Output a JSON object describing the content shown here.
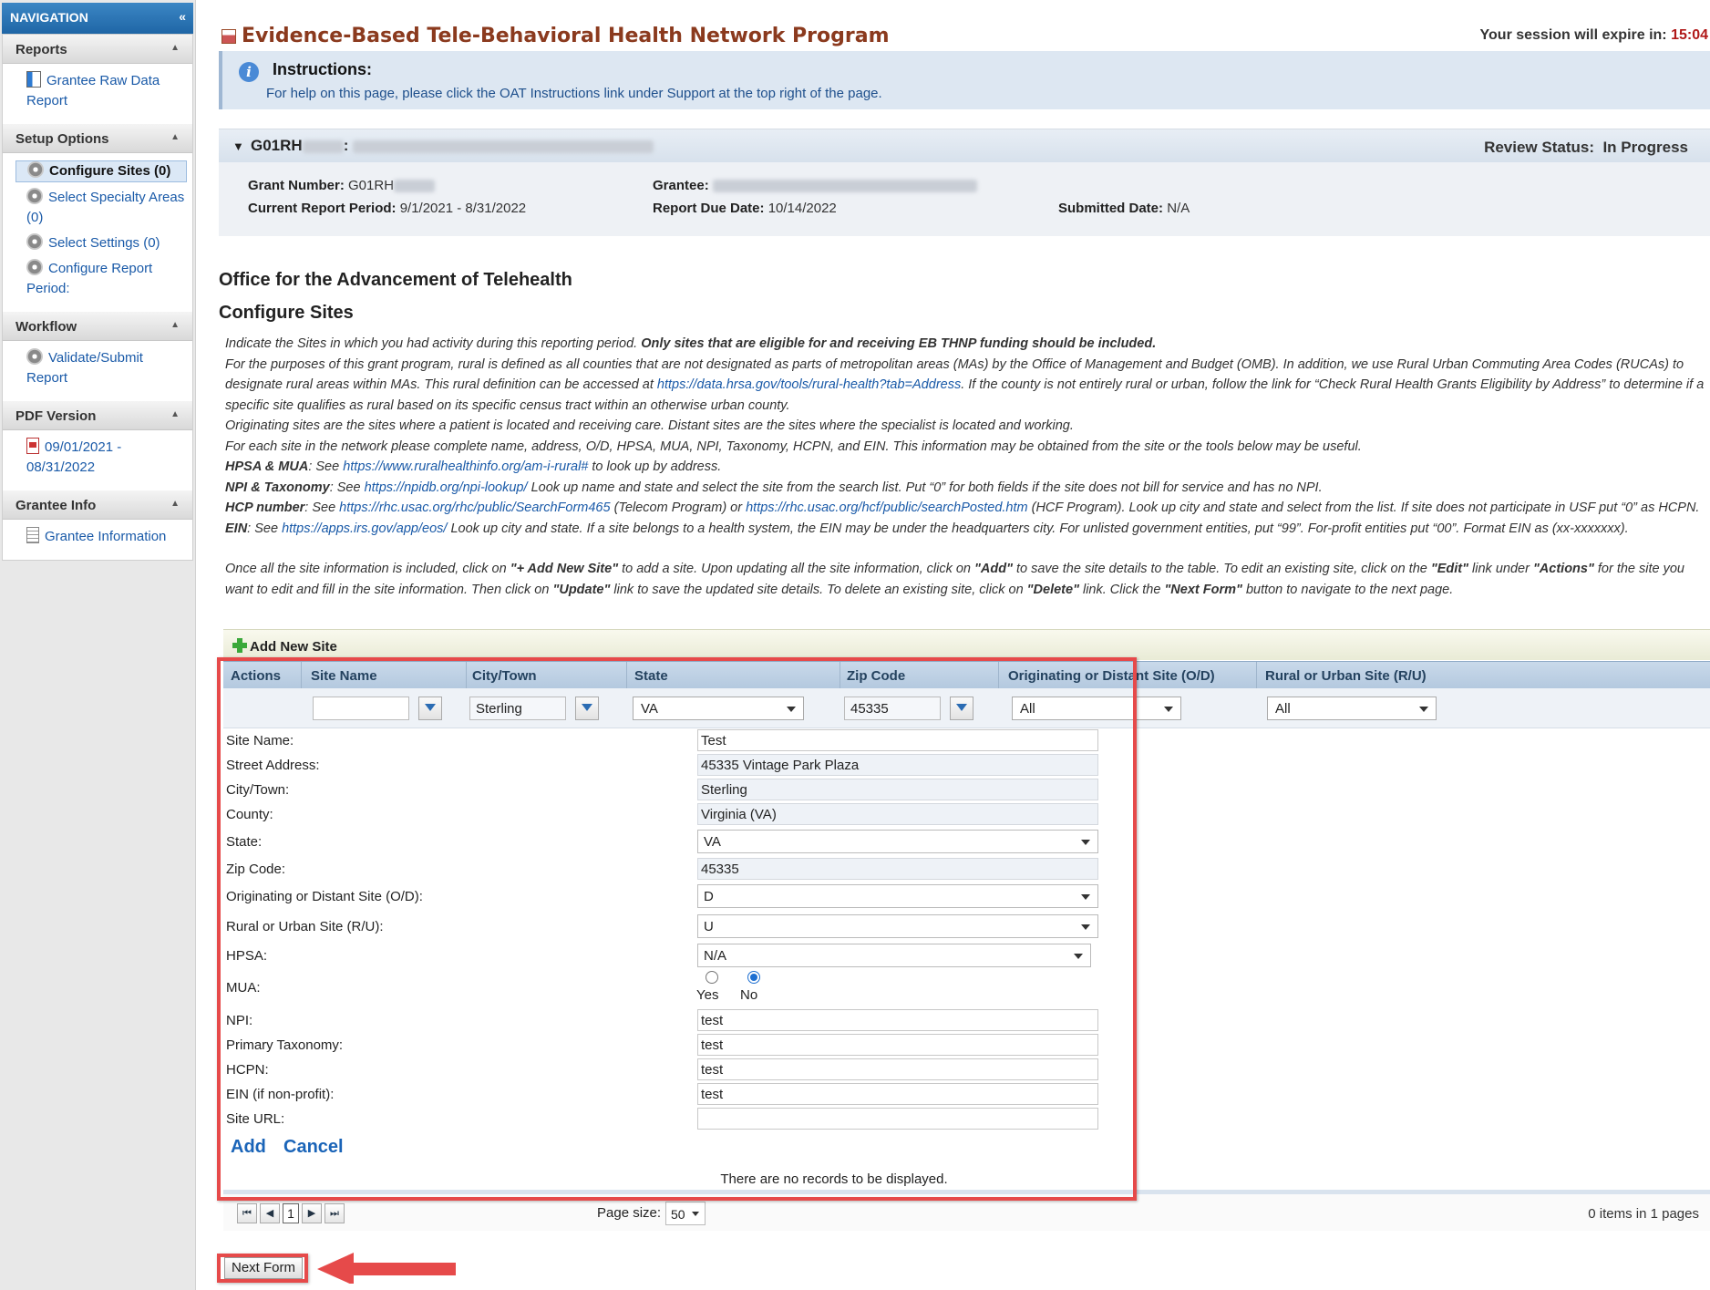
{
  "nav": {
    "title": "NAVIGATION",
    "collapse_icon": "«",
    "sections": [
      {
        "title": "Reports",
        "items": [
          {
            "icon": "report-icon",
            "label": "Grantee Raw Data Report"
          }
        ]
      },
      {
        "title": "Setup Options",
        "items": [
          {
            "icon": "gear-icon",
            "label": "Configure Sites (0)",
            "active": true
          },
          {
            "icon": "gear-icon",
            "label": "Select Specialty Areas (0)"
          },
          {
            "icon": "gear-icon",
            "label": "Select Settings (0)"
          },
          {
            "icon": "gear-icon",
            "label": "Configure Report Period:"
          }
        ]
      },
      {
        "title": "Workflow",
        "items": [
          {
            "icon": "gear-icon",
            "label": "Validate/Submit Report"
          }
        ]
      },
      {
        "title": "PDF Version",
        "items": [
          {
            "icon": "pdf-icon",
            "label": "09/01/2021 - 08/31/2022"
          }
        ]
      },
      {
        "title": "Grantee Info",
        "items": [
          {
            "icon": "document-icon",
            "label": "Grantee Information"
          }
        ]
      }
    ]
  },
  "header": {
    "title": "Evidence-Based Tele-Behavioral Health Network Program",
    "session_label": "Your session will expire in:",
    "session_time": "15:04"
  },
  "instructions": {
    "title": "Instructions:",
    "text": "For help on this page, please click the OAT Instructions link under Support at the top right of the page."
  },
  "grant": {
    "id_prefix": "G01RH",
    "review_status_label": "Review Status:",
    "review_status": "In Progress",
    "grant_number_label": "Grant Number:",
    "grant_number": "G01RH",
    "grantee_label": "Grantee:",
    "period_label": "Current Report Period:",
    "period": "9/1/2021 - 8/31/2022",
    "due_label": "Report Due Date:",
    "due": "10/14/2022",
    "submitted_label": "Submitted Date:",
    "submitted": "N/A"
  },
  "office_title": "Office for the Advancement of Telehealth",
  "page_title": "Configure Sites",
  "description": {
    "p1a": "Indicate the Sites in which you had activity during this reporting period.",
    "p1b": "Only sites that are eligible for and receiving EB THNP funding should be included.",
    "p2a": "For the purposes of this grant program, rural is defined as all counties that are not designated as parts of metropolitan areas (MAs) by the Office of Management and Budget (OMB). In addition, we use Rural Urban Commuting Area Codes (RUCAs) to designate rural areas within MAs. This rural definition can be accessed at",
    "p2link": "https://data.hrsa.gov/tools/rural-health?tab=Address",
    "p2b": ". If the county is not entirely rural or urban, follow the link for “Check Rural Health Grants Eligibility by Address” to determine if a specific site qualifies as rural based on its specific census tract within an otherwise urban county.",
    "p3": "Originating sites are the sites where a patient is located and receiving care. Distant sites are the sites where the specialist is located and working.",
    "p4": "For each site in the network please complete name, address, O/D, HPSA, MUA, NPI, Taxonomy, HCPN, and EIN. This information may be obtained from the site or the tools below may be useful.",
    "hpsa_label": "HPSA & MUA",
    "hpsa_a": ": See",
    "hpsa_link": "https://www.ruralhealthinfo.org/am-i-rural#",
    "hpsa_b": "to look up by address.",
    "npi_label": "NPI & Taxonomy",
    "npi_a": ": See",
    "npi_link": "https://npidb.org/npi-lookup/",
    "npi_b": "Look up name and state and select the site from the search list. Put “0” for both fields if the site does not bill for service and has no NPI.",
    "hcp_label": "HCP number",
    "hcp_a": ": See",
    "hcp_link1": "https://rhc.usac.org/rhc/public/SearchForm465",
    "hcp_b": "(Telecom Program) or",
    "hcp_link2": "https://rhc.usac.org/hcf/public/searchPosted.htm",
    "hcp_c": "(HCF Program). Look up city and state and select from the list. If site does not participate in USF put “0” as HCPN.",
    "ein_label": "EIN",
    "ein_a": ": See",
    "ein_link": "https://apps.irs.gov/app/eos/",
    "ein_b": "Look up city and state. If a site belongs to a health system, the EIN may be under the headquarters city. For unlisted government entities, put “99”. For-profit entities put “00”. Format EIN as (xx-xxxxxxx).",
    "p5_1": "Once all the site information is included, click on",
    "p5_2": "\"+ Add New Site\"",
    "p5_3": "to add a site. Upon updating all the site information, click on",
    "p5_4": "\"Add\"",
    "p5_5": "to save the site details to the table. To edit an existing site, click on the",
    "p5_6": "\"Edit\"",
    "p5_7": "link under",
    "p5_8": "\"Actions\"",
    "p5_9": "for the site you want to edit and fill in the site information. Then click on",
    "p5_10": "\"Update\"",
    "p5_11": "link to save the updated site details. To delete an existing site, click on",
    "p5_12": "\"Delete\"",
    "p5_13": "link. Click the",
    "p5_14": "\"Next Form\"",
    "p5_15": "button to navigate to the next page."
  },
  "grid": {
    "add_label": "Add New Site",
    "columns": [
      "Actions",
      "Site Name",
      "City/Town",
      "State",
      "Zip Code",
      "Originating or Distant Site (O/D)",
      "Rural or Urban Site (R/U)"
    ],
    "filters": {
      "site_name": "",
      "city": "Sterling",
      "state": "VA",
      "zip": "45335",
      "od": "All",
      "ru": "All"
    },
    "no_records": "There are no records to be displayed."
  },
  "form": {
    "site_name_label": "Site Name:",
    "site_name": "Test",
    "street_label": "Street Address:",
    "street": "45335 Vintage Park Plaza",
    "city_label": "City/Town:",
    "city": "Sterling",
    "county_label": "County:",
    "county": "Virginia (VA)",
    "state_label": "State:",
    "state": "VA",
    "zip_label": "Zip Code:",
    "zip": "45335",
    "od_label": "Originating or Distant Site (O/D):",
    "od": "D",
    "ru_label": "Rural or Urban Site (R/U):",
    "ru": "U",
    "hpsa_label": "HPSA:",
    "hpsa": "N/A",
    "mua_label": "MUA:",
    "mua_yes": "Yes",
    "mua_no": "No",
    "npi_label": "NPI:",
    "npi": "test",
    "taxonomy_label": "Primary Taxonomy:",
    "taxonomy": "test",
    "hcpn_label": "HCPN:",
    "hcpn": "test",
    "ein_label": "EIN (if non-profit):",
    "ein": "test",
    "url_label": "Site URL:",
    "url": "",
    "add_label": "Add",
    "cancel_label": "Cancel"
  },
  "pager": {
    "current": "1",
    "size_label": "Page size:",
    "size": "50",
    "info": "0 items in 1 pages"
  },
  "next_form": "Next Form",
  "colors": {
    "accent": "#1a5aa8",
    "title": "#8b3a1e",
    "highlight": "#e64a4a"
  }
}
